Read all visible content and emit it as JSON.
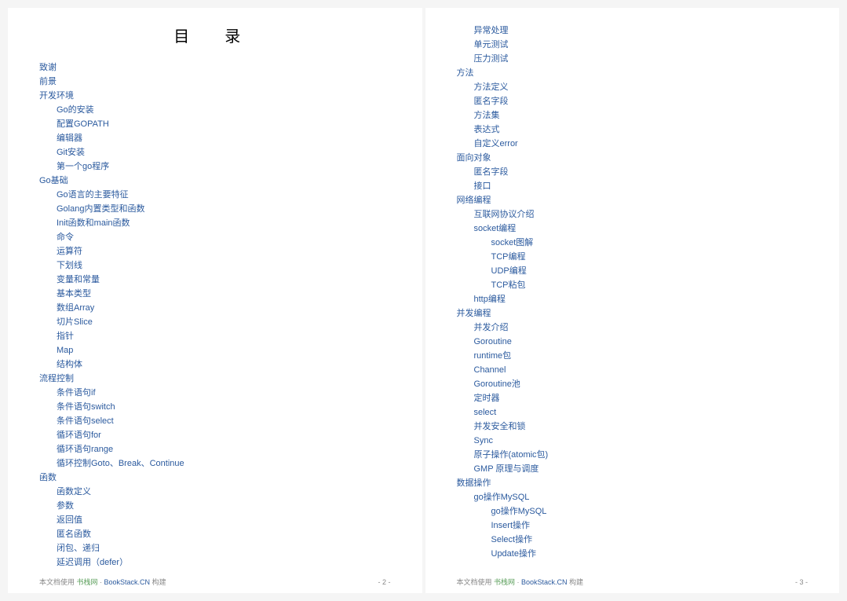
{
  "title": "目 录",
  "page_left": {
    "items": [
      {
        "label": "致谢",
        "level": 0
      },
      {
        "label": "前景",
        "level": 0
      },
      {
        "label": "开发环境",
        "level": 0
      },
      {
        "label": "Go的安装",
        "level": 1
      },
      {
        "label": "配置GOPATH",
        "level": 1
      },
      {
        "label": "编辑器",
        "level": 1
      },
      {
        "label": "Git安装",
        "level": 1
      },
      {
        "label": "第一个go程序",
        "level": 1
      },
      {
        "label": "Go基础",
        "level": 0
      },
      {
        "label": "Go语言的主要特征",
        "level": 1
      },
      {
        "label": "Golang内置类型和函数",
        "level": 1
      },
      {
        "label": "Init函数和main函数",
        "level": 1
      },
      {
        "label": "命令",
        "level": 1
      },
      {
        "label": "运算符",
        "level": 1
      },
      {
        "label": "下划线",
        "level": 1
      },
      {
        "label": "变量和常量",
        "level": 1
      },
      {
        "label": "基本类型",
        "level": 1
      },
      {
        "label": "数组Array",
        "level": 1
      },
      {
        "label": "切片Slice",
        "level": 1
      },
      {
        "label": "指针",
        "level": 1
      },
      {
        "label": "Map",
        "level": 1
      },
      {
        "label": "结构体",
        "level": 1
      },
      {
        "label": "流程控制",
        "level": 0
      },
      {
        "label": "条件语句if",
        "level": 1
      },
      {
        "label": "条件语句switch",
        "level": 1
      },
      {
        "label": "条件语句select",
        "level": 1
      },
      {
        "label": "循环语句for",
        "level": 1
      },
      {
        "label": "循环语句range",
        "level": 1
      },
      {
        "label": "循环控制Goto、Break、Continue",
        "level": 1
      },
      {
        "label": "函数",
        "level": 0
      },
      {
        "label": "函数定义",
        "level": 1
      },
      {
        "label": "参数",
        "level": 1
      },
      {
        "label": "返回值",
        "level": 1
      },
      {
        "label": "匿名函数",
        "level": 1
      },
      {
        "label": "闭包、递归",
        "level": 1
      },
      {
        "label": "延迟调用（defer）",
        "level": 1
      }
    ],
    "footer": {
      "prefix": "本文档使用 ",
      "brand": "书栈网",
      "sep": " · ",
      "site": "BookStack.CN",
      "suffix": " 构建",
      "page_number": "- 2 -"
    }
  },
  "page_right": {
    "items": [
      {
        "label": "异常处理",
        "level": 1
      },
      {
        "label": "单元测试",
        "level": 1
      },
      {
        "label": "压力测试",
        "level": 1
      },
      {
        "label": "方法",
        "level": 0
      },
      {
        "label": "方法定义",
        "level": 1
      },
      {
        "label": "匿名字段",
        "level": 1
      },
      {
        "label": "方法集",
        "level": 1
      },
      {
        "label": "表达式",
        "level": 1
      },
      {
        "label": "自定义error",
        "level": 1
      },
      {
        "label": "面向对象",
        "level": 0
      },
      {
        "label": "匿名字段",
        "level": 1
      },
      {
        "label": "接口",
        "level": 1
      },
      {
        "label": "网络编程",
        "level": 0
      },
      {
        "label": "互联网协议介绍",
        "level": 1
      },
      {
        "label": "socket编程",
        "level": 1
      },
      {
        "label": "socket图解",
        "level": 2
      },
      {
        "label": "TCP编程",
        "level": 2
      },
      {
        "label": "UDP编程",
        "level": 2
      },
      {
        "label": "TCP粘包",
        "level": 2
      },
      {
        "label": "http编程",
        "level": 1
      },
      {
        "label": "并发编程",
        "level": 0
      },
      {
        "label": "并发介绍",
        "level": 1
      },
      {
        "label": "Goroutine",
        "level": 1
      },
      {
        "label": "runtime包",
        "level": 1
      },
      {
        "label": "Channel",
        "level": 1
      },
      {
        "label": "Goroutine池",
        "level": 1
      },
      {
        "label": "定时器",
        "level": 1
      },
      {
        "label": "select",
        "level": 1
      },
      {
        "label": "并发安全和锁",
        "level": 1
      },
      {
        "label": "Sync",
        "level": 1
      },
      {
        "label": "原子操作(atomic包)",
        "level": 1
      },
      {
        "label": "GMP 原理与调度",
        "level": 1
      },
      {
        "label": "数据操作",
        "level": 0
      },
      {
        "label": "go操作MySQL",
        "level": 1
      },
      {
        "label": "go操作MySQL",
        "level": 2
      },
      {
        "label": "Insert操作",
        "level": 2
      },
      {
        "label": "Select操作",
        "level": 2
      },
      {
        "label": "Update操作",
        "level": 2
      }
    ],
    "footer": {
      "prefix": "本文档使用 ",
      "brand": "书栈网",
      "sep": " · ",
      "site": "BookStack.CN",
      "suffix": " 构建",
      "page_number": "- 3 -"
    }
  }
}
